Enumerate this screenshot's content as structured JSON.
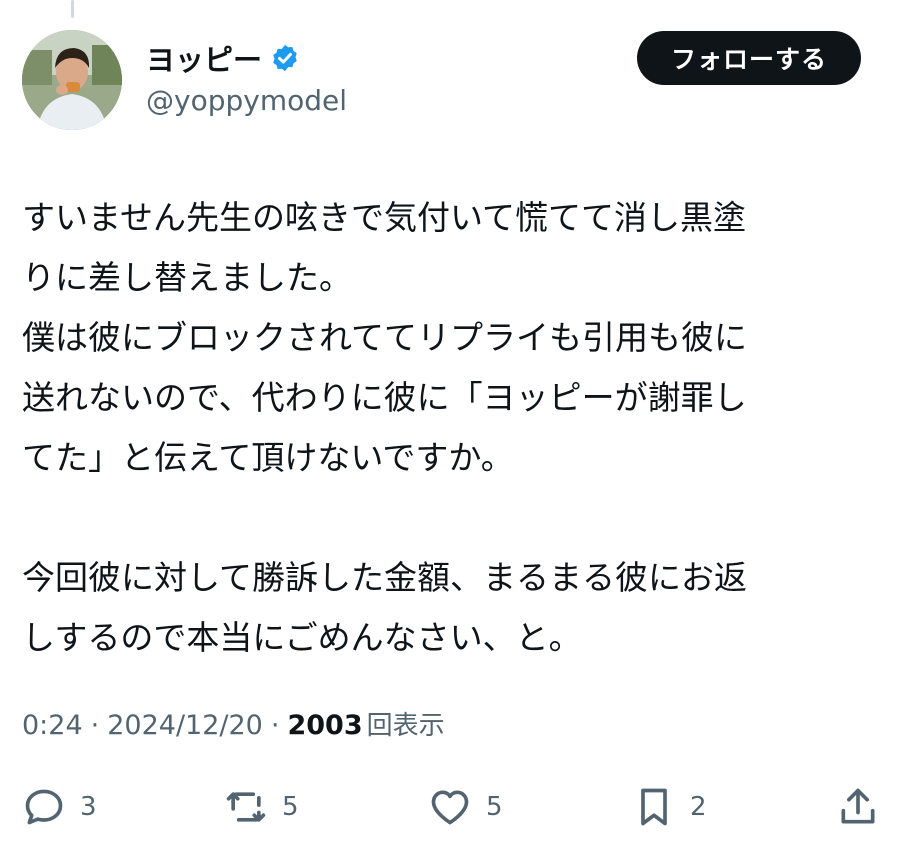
{
  "user": {
    "display_name": "ヨッピー",
    "handle": "@yoppymodel",
    "verified": true,
    "verified_color": "#1d9bf0"
  },
  "follow_button": {
    "label": "フォローする"
  },
  "tweet": {
    "lines": [
      "すいません先生の呟きで気付いて慌てて消し黒塗",
      "りに差し替えました。",
      "僕は彼にブロックされててリプライも引用も彼に",
      "送れないので、代わりに彼に「ヨッピーが謝罪し",
      "てた」と伝えて頂けないですか。",
      "",
      "今回彼に対して勝訴した金額、まるまる彼にお返",
      "しするので本当にごめんなさい、と。"
    ]
  },
  "meta": {
    "time": "0:24",
    "separator": "·",
    "date": "2024/12/20",
    "views_count": "2003",
    "views_label": "回表示"
  },
  "actions": {
    "reply": {
      "icon": "reply-icon",
      "count": "3"
    },
    "repost": {
      "icon": "repost-icon",
      "count": "5"
    },
    "like": {
      "icon": "like-icon",
      "count": "5"
    },
    "bookmark": {
      "icon": "bookmark-icon",
      "count": "2"
    },
    "share": {
      "icon": "share-icon"
    }
  }
}
